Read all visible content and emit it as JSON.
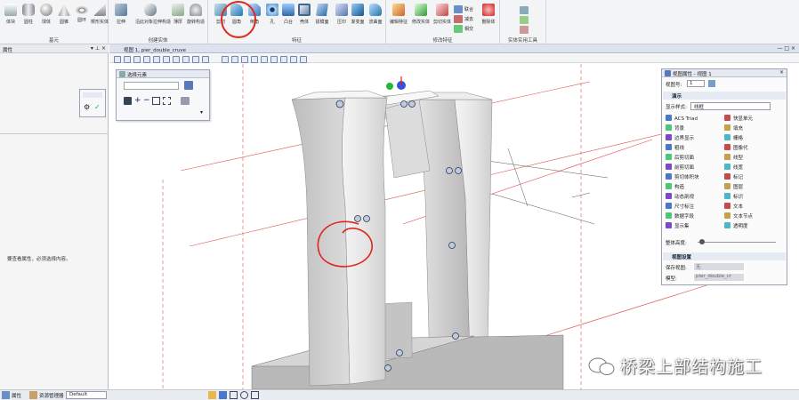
{
  "ribbon": {
    "groups": [
      {
        "label": "基元",
        "buttons": [
          "体块",
          "圆柱",
          "球体",
          "圆锥",
          "圆环",
          "楔形实体"
        ]
      },
      {
        "label": "创建实体",
        "buttons": [
          "拉伸",
          "沿此对象拉伸构造",
          "薄厚",
          "旋转构造"
        ]
      },
      {
        "label": "特征",
        "buttons": [
          "剪切",
          "圆角",
          "倒角",
          "孔",
          "凸台",
          "壳体",
          "拔模面",
          "压印",
          "渐变面",
          "流曲面"
        ]
      },
      {
        "label": "修改特征",
        "buttons": [
          "编辑特征",
          "修改实体",
          "剪切实体"
        ],
        "small": [
          "联合",
          "减去",
          "相交",
          "删除体"
        ]
      },
      {
        "label": "实体实用工具",
        "buttons": []
      }
    ]
  },
  "left_panel": {
    "title": "属性",
    "empty_message": "要查看属性，必须选择内容。",
    "tabs": [
      "属性",
      "资源管理器"
    ]
  },
  "viewport": {
    "title": "视图 1, pier_double_cruve"
  },
  "select_tool": {
    "title": "选择元素"
  },
  "attr_panel": {
    "title": "视图属性 - 视图 1",
    "view_number_label": "视图号:",
    "view_number": "1",
    "display_section": "演示",
    "display_style_label": "显示样式:",
    "display_style_value": "线框",
    "items": [
      "ACS Triad",
      "快显单元",
      "背景",
      "填充",
      "边界显示",
      "栅格",
      "粗线",
      "图像代",
      "后剪切面",
      "线型",
      "前剪切面",
      "线宽",
      "剪切体积块",
      "标记",
      "构造",
      "图层",
      "动态剖视",
      "标识",
      "尺寸标注",
      "文本",
      "数据字段",
      "文本节点",
      "显示集",
      "透明度"
    ],
    "body_height_label": "整体高度:",
    "saved_view_section": "视图设置",
    "saved_view_label": "保存视图:",
    "saved_view_value": "无",
    "model_label": "模型:",
    "model_value": "pier_double_cr"
  },
  "statusbar": {
    "level": "Default"
  },
  "watermark": "桥梁上部结构施工",
  "colors": {
    "ribbon_bg": "#f3f4f6",
    "highlight_red": "#e0261f",
    "pier_light": "#f0f0f0",
    "pier_mid": "#d6d6d6",
    "pier_dark": "#a9a9a9"
  }
}
